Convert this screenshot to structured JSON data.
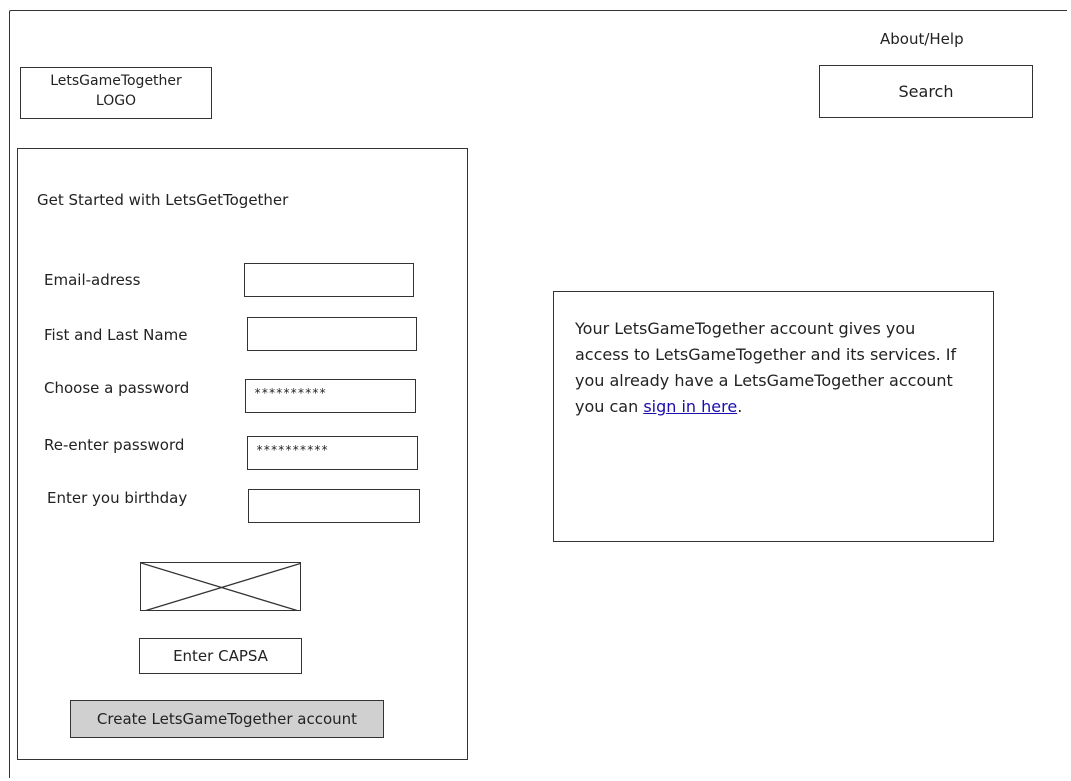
{
  "header": {
    "about_help": "About/Help",
    "logo_line1": "LetsGameTogether",
    "logo_line2": "LOGO",
    "search_label": "Search"
  },
  "form": {
    "heading": "Get Started with LetsGetTogether",
    "fields": [
      {
        "label": "Email-adress",
        "value": ""
      },
      {
        "label": "Fist and Last Name",
        "value": ""
      },
      {
        "label": "Choose a password",
        "value": "**********"
      },
      {
        "label": "Re-enter password",
        "value": "**********"
      },
      {
        "label": "Enter you birthday",
        "value": ""
      }
    ],
    "captcha_label": "Enter CAPSA",
    "submit_label": "Create LetsGameTogether account"
  },
  "info": {
    "text": "Your LetsGameTogether account gives you access to LetsGameTogether and its services. If you already have a LetsGameTogether account you can ",
    "link_text": "sign in here",
    "after_link": "."
  }
}
